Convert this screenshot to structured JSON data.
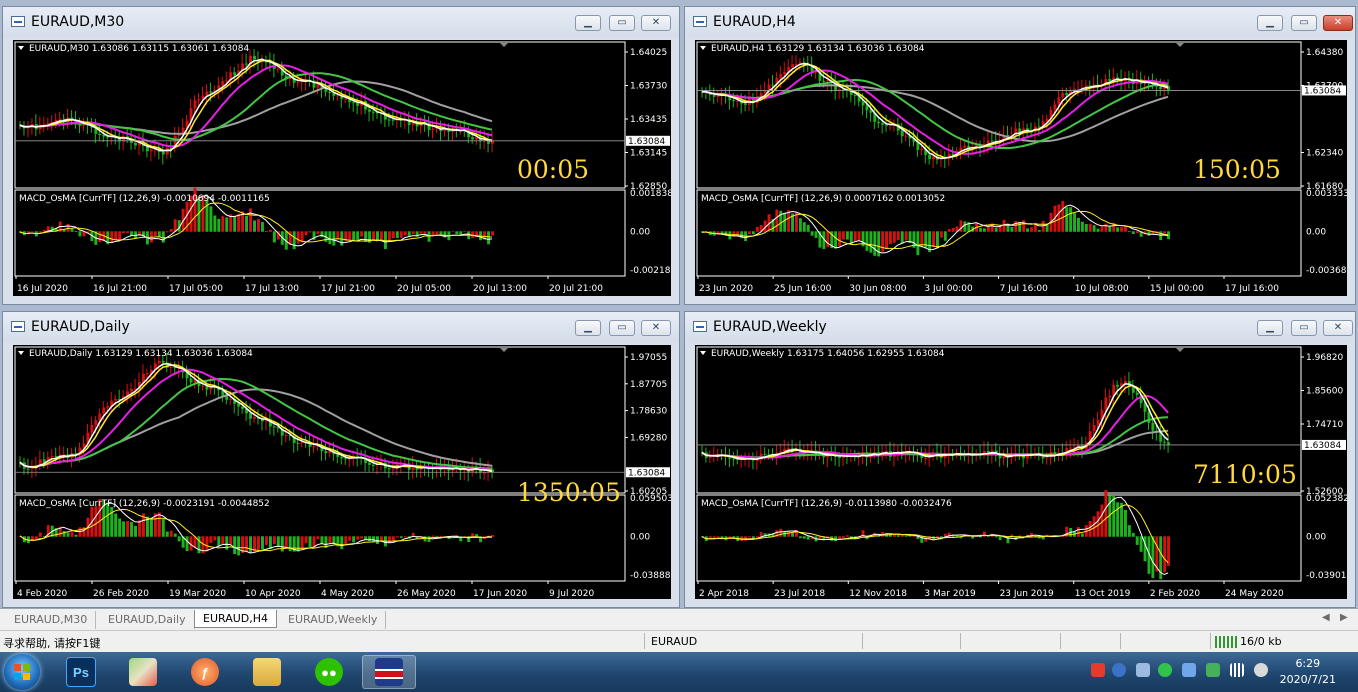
{
  "windows": [
    {
      "id": "m30",
      "title": "EURAUD,M30",
      "header": "EURAUD,M30  1.63086 1.63115 1.63061 1.63084",
      "price_ticks": [
        "1.64025",
        "1.63730",
        "1.63435",
        "1.63145",
        "1.62850"
      ],
      "current_price": "1.63084",
      "timer": "00:05",
      "macd_header": "MACD_OsMA [CurrTF] (12,26,9) -0.0010694 -0.0011165",
      "macd_ticks": [
        "0.0018384",
        "0.00",
        "-0.002182"
      ],
      "dates": [
        "16 Jul 2020",
        "16 Jul 21:00",
        "17 Jul 05:00",
        "17 Jul 13:00",
        "17 Jul 21:00",
        "20 Jul 05:00",
        "20 Jul 13:00",
        "20 Jul 21:00"
      ]
    },
    {
      "id": "h4",
      "title": "EURAUD,H4",
      "header": "EURAUD,H4  1.63129 1.63134 1.63036 1.63084",
      "price_ticks": [
        "1.64380",
        "1.63700",
        "1.63084",
        "1.62340",
        "1.61680"
      ],
      "current_price": "1.63084",
      "timer": "150:05",
      "macd_header": "MACD_OsMA [CurrTF] (12,26,9) 0.0007162 0.0013052",
      "macd_ticks": [
        "0.0033335",
        "0.00",
        "-0.003681"
      ],
      "dates": [
        "23 Jun 2020",
        "25 Jun 16:00",
        "30 Jun 08:00",
        "3 Jul 00:00",
        "7 Jul 16:00",
        "10 Jul 08:00",
        "15 Jul 00:00",
        "17 Jul 16:00"
      ]
    },
    {
      "id": "daily",
      "title": "EURAUD,Daily",
      "header": "EURAUD,Daily  1.63129 1.63134 1.63036 1.63084",
      "price_ticks": [
        "1.97055",
        "1.87705",
        "1.78630",
        "1.69280",
        "1.63084",
        "1.60205"
      ],
      "current_price": "1.63084",
      "timer": "1350:05",
      "macd_header": "MACD_OsMA [CurrTF] (12,26,9) -0.0023191 -0.0044852",
      "macd_ticks": [
        "0.0595038",
        "0.00",
        "-0.038889"
      ],
      "dates": [
        "4 Feb 2020",
        "26 Feb 2020",
        "19 Mar 2020",
        "10 Apr 2020",
        "4 May 2020",
        "26 May 2020",
        "17 Jun 2020",
        "9 Jul 2020"
      ]
    },
    {
      "id": "weekly",
      "title": "EURAUD,Weekly",
      "header": "EURAUD,Weekly  1.63175 1.64056 1.62955 1.63084",
      "price_ticks": [
        "1.96820",
        "1.85600",
        "1.74710",
        "1.63084",
        "1.52600"
      ],
      "current_price": "1.63084",
      "timer": "7110:05",
      "macd_header": "MACD_OsMA [CurrTF] (12,26,9) -0.0113980 -0.0032476",
      "macd_ticks": [
        "0.0523829",
        "0.00",
        "-0.039012"
      ],
      "dates": [
        "2 Apr 2018",
        "23 Jul 2018",
        "12 Nov 2018",
        "3 Mar 2019",
        "23 Jun 2019",
        "13 Oct 2019",
        "2 Feb 2020",
        "24 May 2020"
      ]
    }
  ],
  "tabs": [
    "EURAUD,M30",
    "EURAUD,Daily",
    "EURAUD,H4",
    "EURAUD,Weekly"
  ],
  "active_tab": "EURAUD,H4",
  "status": {
    "help": "寻求帮助, 请按F1键",
    "symbol": "EURAUD",
    "traffic": "16/0 kb"
  },
  "taskbar": {
    "apps": [
      "start-button",
      "photoshop",
      "maps",
      "flash",
      "file-explorer",
      "wechat",
      "metatrader"
    ],
    "time": "6:29",
    "date": "2020/7/21"
  },
  "colors": {
    "bull": "#d80f0f",
    "bear": "#1db31d",
    "ma_fast": "#ffffff",
    "ma_yellow": "#ffee22",
    "ma_magenta": "#e61ee6",
    "ma_green": "#44c544",
    "ma_gray": "#a0a0a0",
    "timer": "#ffd83b"
  }
}
